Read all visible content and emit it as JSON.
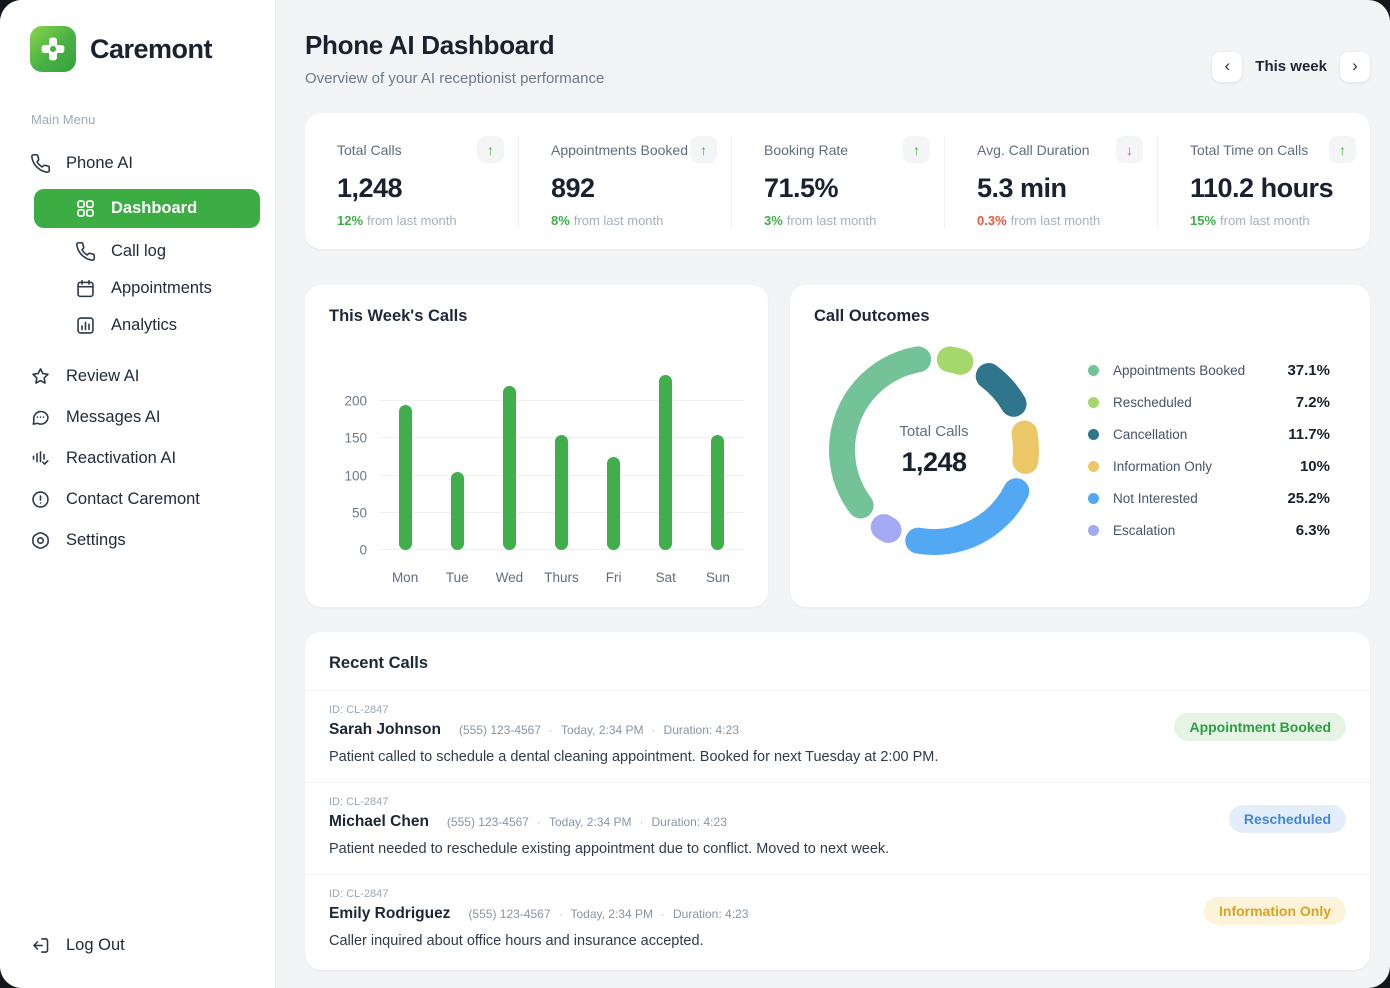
{
  "colors": {
    "accent_green": "#3BAD43",
    "bar_green": "#3FAE4B",
    "delta_up": "#3FAE4A",
    "delta_down": "#E8563F",
    "page_background": "#F2F4F6"
  },
  "brand": {
    "name": "Caremont"
  },
  "sidebar": {
    "section_label": "Main Menu",
    "items": [
      {
        "label": "Phone AI"
      },
      {
        "label": "Dashboard"
      },
      {
        "label": "Call log"
      },
      {
        "label": "Appointments"
      },
      {
        "label": "Analytics"
      },
      {
        "label": "Review AI"
      },
      {
        "label": "Messages AI"
      },
      {
        "label": "Reactivation AI"
      },
      {
        "label": "Contact Caremont"
      },
      {
        "label": "Settings"
      }
    ],
    "logout_label": "Log Out"
  },
  "header": {
    "title": "Phone AI Dashboard",
    "subtitle": "Overview of your AI receptionist performance",
    "period": {
      "label": "This week",
      "prev_icon": "‹",
      "next_icon": "›"
    }
  },
  "stats": [
    {
      "label": "Total Calls",
      "value": "1,248",
      "delta_pct": "12%",
      "delta_text": "from last month",
      "trend": "up",
      "trend_icon": "↑"
    },
    {
      "label": "Appointments Booked",
      "value": "892",
      "delta_pct": "8%",
      "delta_text": "from last month",
      "trend": "up",
      "trend_icon": "↑"
    },
    {
      "label": "Booking Rate",
      "value": "71.5%",
      "delta_pct": "3%",
      "delta_text": "from last month",
      "trend": "up",
      "trend_icon": "↑"
    },
    {
      "label": "Avg. Call Duration",
      "value": "5.3 min",
      "delta_pct": "0.3%",
      "delta_text": "from last month",
      "trend": "down",
      "trend_icon": "↓"
    },
    {
      "label": "Total Time on Calls",
      "value": "110.2 hours",
      "delta_pct": "15%",
      "delta_text": "from last month",
      "trend": "up",
      "trend_icon": "↑"
    }
  ],
  "chart_data": [
    {
      "type": "bar",
      "title": "This Week's Calls",
      "categories": [
        "Mon",
        "Tue",
        "Wed",
        "Thurs",
        "Fri",
        "Sat",
        "Sun"
      ],
      "values": [
        195,
        105,
        220,
        155,
        125,
        235,
        155
      ],
      "xlabel": "",
      "ylabel": "",
      "ylim": [
        0,
        250
      ],
      "yticks": [
        0,
        50,
        100,
        150,
        200
      ],
      "grid": "horizontal",
      "bar_color": "#3FAE4B"
    },
    {
      "type": "pie",
      "variant": "donut",
      "title": "Call Outcomes",
      "center_label": "Total Calls",
      "center_value": "1,248",
      "legend_position": "right",
      "slices": [
        {
          "label": "Appointments Booked",
          "value": 37.1,
          "display": "37.1%",
          "color": "#74C298"
        },
        {
          "label": "Rescheduled",
          "value": 7.2,
          "display": "7.2%",
          "color": "#A4D86C"
        },
        {
          "label": "Cancellation",
          "value": 11.7,
          "display": "11.7%",
          "color": "#2F758B"
        },
        {
          "label": "Information Only",
          "value": 10,
          "display": "10%",
          "color": "#ECC768"
        },
        {
          "label": "Not Interested",
          "value": 25.2,
          "display": "25.2%",
          "color": "#52A8F2"
        },
        {
          "label": "Escalation",
          "value": 6.3,
          "display": "6.3%",
          "color": "#A3AAF2"
        }
      ]
    }
  ],
  "recent_calls": {
    "title": "Recent Calls",
    "meta_separator": "·",
    "rows": [
      {
        "id": "ID: CL-2847",
        "name": "Sarah Johnson",
        "phone": "(555) 123-4567",
        "time": "Today, 2:34 PM",
        "duration": "Duration: 4:23",
        "description": "Patient called to schedule a dental cleaning appointment. Booked for next Tuesday at 2:00 PM.",
        "badge": "Appointment Booked",
        "badge_variant": "success"
      },
      {
        "id": "ID: CL-2847",
        "name": "Michael Chen",
        "phone": "(555) 123-4567",
        "time": "Today, 2:34 PM",
        "duration": "Duration: 4:23",
        "description": "Patient needed to reschedule existing appointment due to conflict. Moved to next week.",
        "badge": "Rescheduled",
        "badge_variant": "info"
      },
      {
        "id": "ID: CL-2847",
        "name": "Emily Rodriguez",
        "phone": "(555) 123-4567",
        "time": "Today, 2:34 PM",
        "duration": "Duration: 4:23",
        "description": "Caller inquired about office hours and insurance accepted.",
        "badge": "Information Only",
        "badge_variant": "warning"
      }
    ]
  }
}
